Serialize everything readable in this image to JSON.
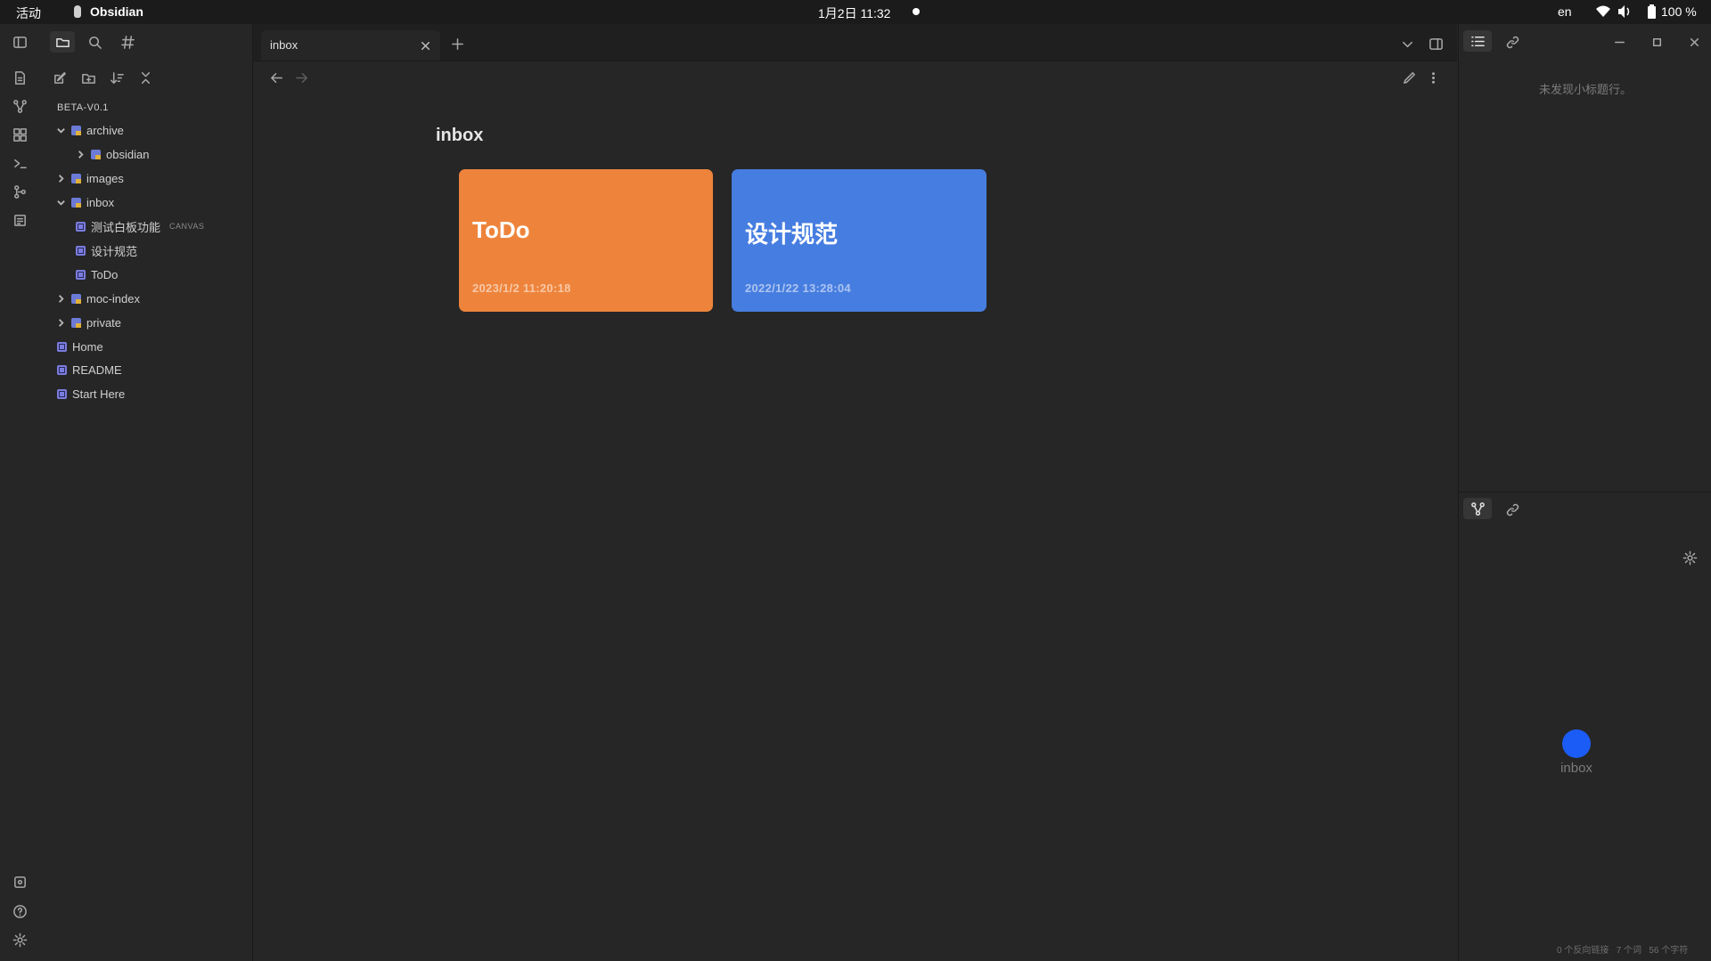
{
  "topbar": {
    "activities": "活动",
    "app_name": "Obsidian",
    "datetime": "1月2日  11:32",
    "lang": "en",
    "battery": "100 %"
  },
  "sidebar": {
    "vault_name": "BETA-V0.1",
    "tree": [
      {
        "label": "archive",
        "tag": ""
      },
      {
        "label": "obsidian",
        "tag": ""
      },
      {
        "label": "images",
        "tag": ""
      },
      {
        "label": "inbox",
        "tag": ""
      },
      {
        "label": "测试白板功能",
        "tag": "CANVAS"
      },
      {
        "label": "设计规范",
        "tag": ""
      },
      {
        "label": "ToDo",
        "tag": ""
      },
      {
        "label": "moc-index",
        "tag": ""
      },
      {
        "label": "private",
        "tag": ""
      },
      {
        "label": "Home",
        "tag": ""
      },
      {
        "label": "README",
        "tag": ""
      },
      {
        "label": "Start Here",
        "tag": ""
      }
    ]
  },
  "tab": {
    "title": "inbox"
  },
  "main": {
    "heading": "inbox",
    "cards": [
      {
        "title": "ToDo",
        "date": "2023/1/2 11:20:18",
        "color": "#ee843b"
      },
      {
        "title": "设计规范",
        "date": "2022/1/22 13:28:04",
        "color": "#467de0"
      }
    ]
  },
  "right_panel": {
    "outline_empty": "未发现小标题行。",
    "graph_node_label": "inbox",
    "graph_node_color": "#1b5cf6",
    "status_backlinks": "0 个反向链接",
    "status_words": "7 个词",
    "status_chars": "56 个字符"
  },
  "icons": [
    "sidebar-toggle-icon",
    "folder-icon",
    "search-icon",
    "hashtag-icon",
    "files-icon",
    "graph-icon",
    "grid-icon",
    "terminal-icon",
    "git-icon",
    "list-add-icon",
    "vault-icon",
    "help-icon",
    "gear-icon",
    "new-note-icon",
    "new-folder-icon",
    "sort-icon",
    "collapse-icon",
    "close-icon",
    "plus-icon",
    "chevron-down-icon",
    "layout-icon",
    "outline-icon",
    "link-icon",
    "back-arrow-icon",
    "forward-arrow-icon",
    "edit-icon",
    "more-icon",
    "minimize-icon",
    "maximize-icon",
    "wifi-icon",
    "volume-icon",
    "battery-icon"
  ]
}
